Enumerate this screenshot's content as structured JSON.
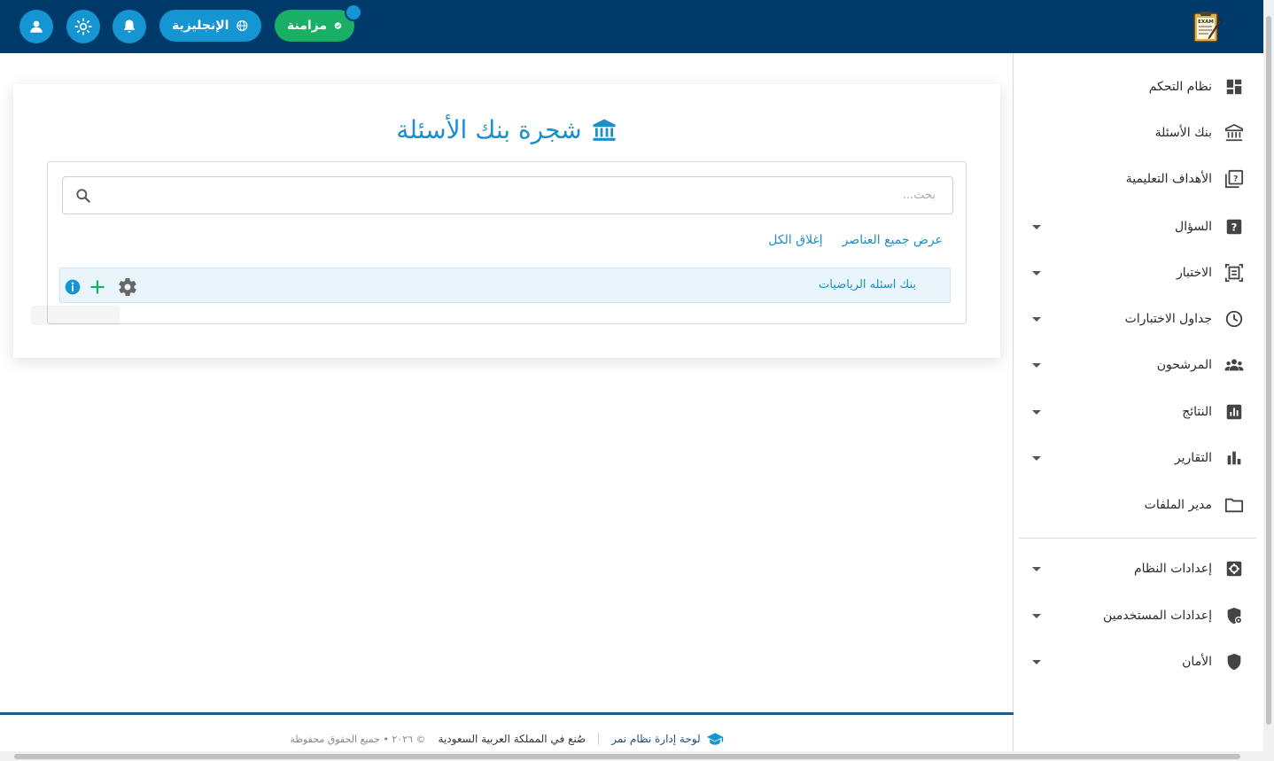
{
  "header": {
    "language_label": "الإنجليزية",
    "sync_label": "مزامنة",
    "logo_text": "EXAM"
  },
  "sidebar": {
    "items": [
      {
        "label": "نظام التحكم",
        "icon": "dashboard-icon",
        "has_caret": false
      },
      {
        "label": "بنك الأسئلة",
        "icon": "bank-icon",
        "has_caret": false
      },
      {
        "label": "الأهداف التعليمية",
        "icon": "learning-objectives-icon",
        "has_caret": false
      },
      {
        "label": "السؤال",
        "icon": "question-icon",
        "has_caret": true
      },
      {
        "label": "الاختبار",
        "icon": "exam-icon",
        "has_caret": true
      },
      {
        "label": "جداول الاختبارات",
        "icon": "clock-icon",
        "has_caret": true
      },
      {
        "label": "المرشحون",
        "icon": "candidates-icon",
        "has_caret": true
      },
      {
        "label": "النتائج",
        "icon": "results-icon",
        "has_caret": true
      },
      {
        "label": "التقارير",
        "icon": "reports-icon",
        "has_caret": true
      },
      {
        "label": "مدير الملفات",
        "icon": "folder-icon",
        "has_caret": false
      },
      {
        "label": "إعدادات النظام",
        "icon": "system-settings-icon",
        "has_caret": true
      },
      {
        "label": "إعدادات المستخدمين",
        "icon": "user-settings-icon",
        "has_caret": true
      },
      {
        "label": "الأمان",
        "icon": "shield-icon",
        "has_caret": true
      }
    ]
  },
  "main": {
    "title": "شجرة بنك الأسئلة",
    "search_placeholder": "بحث...",
    "expand_all": "عرض جميع العناصر",
    "collapse_all": "إغلاق الكل",
    "tree": [
      {
        "label": "بنك اسئله الرياضيات"
      }
    ]
  },
  "footer": {
    "brand": "لوحة إدارة نظام نمر",
    "made_in": "صُنع في المملكة العربية السعودية",
    "copyright": "© ٢٠٢٦ • جميع الحقوق محفوظة"
  },
  "colors": {
    "topbar": "#003a6b",
    "accent": "#1596d3",
    "sync": "#19b065",
    "title": "#1a8fc9"
  }
}
